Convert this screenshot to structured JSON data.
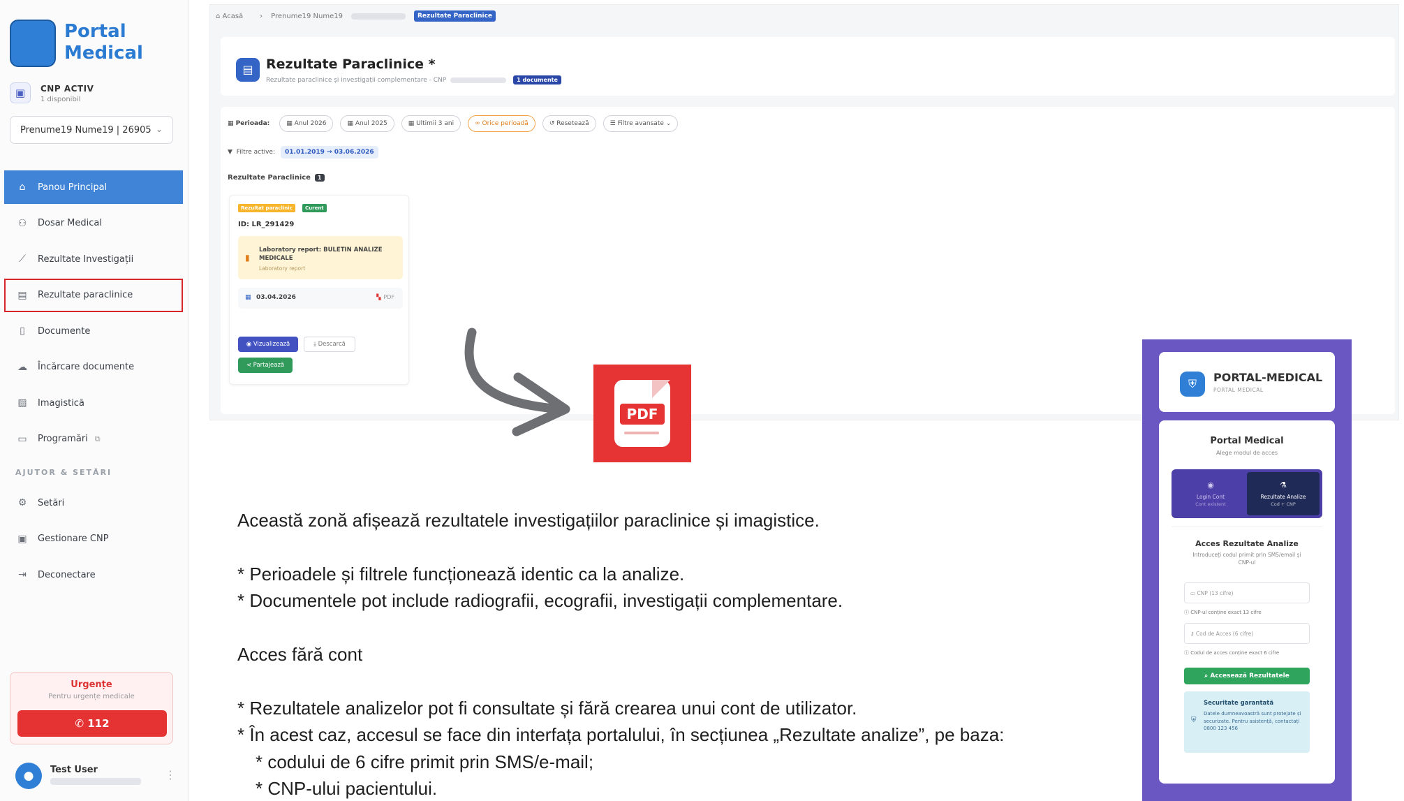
{
  "sidebar": {
    "logo_text": "Portal Medical",
    "cnp_title": "CNP ACTIV",
    "cnp_sub": "1 disponibil",
    "patient_select": "Prenume19 Nume19 | 26905",
    "nav": [
      {
        "label": "Panou Principal",
        "icon": "home-icon"
      },
      {
        "label": "Dosar Medical",
        "icon": "users-icon"
      },
      {
        "label": "Rezultate Investigații",
        "icon": "chart-icon"
      },
      {
        "label": "Rezultate paraclinice",
        "icon": "clipboard-icon"
      },
      {
        "label": "Documente",
        "icon": "document-icon"
      },
      {
        "label": "Încărcare documente",
        "icon": "cloud-upload-icon"
      },
      {
        "label": "Imagistică",
        "icon": "image-icon"
      },
      {
        "label": "Programări",
        "icon": "calendar-icon"
      }
    ],
    "section_label": "AJUTOR & SETĂRI",
    "nav2": [
      {
        "label": "Setări",
        "icon": "gear-icon"
      },
      {
        "label": "Gestionare CNP",
        "icon": "id-card-icon"
      },
      {
        "label": "Deconectare",
        "icon": "logout-icon"
      }
    ],
    "urgent_title": "Urgențe",
    "urgent_sub": "Pentru urgențe medicale",
    "urgent_phone": "112",
    "user_name": "Test User",
    "colors": {
      "active": "#3f84d7",
      "highlight": "#d7262c",
      "urgent": "#e53233"
    }
  },
  "main": {
    "breadcrumb": [
      "Acasă",
      "Prenume19 Nume19"
    ],
    "breadcrumb_active": "Rezultate Paraclinice",
    "title": "Rezultate Paraclinice *",
    "subtitle": "Rezultate paraclinice și investigații complementare - CNP",
    "doc_badge": "1 documente",
    "period_label": "Perioada:",
    "period_chips": [
      "Anul 2026",
      "Anul 2025",
      "Ultimii 3 ani",
      "Orice perioadă",
      "Resetează",
      "Filtre avansate"
    ],
    "active_label": "Filtre active:",
    "active_range": "01.01.2019 → 03.06.2026",
    "results_label": "Rezultate Paraclinice",
    "results_count": "1",
    "card": {
      "tag_type": "Rezultat paraclinic",
      "tag_status": "Curent",
      "id": "ID: LR_291429",
      "lab_title": "Laboratory report: BULETIN ANALIZE MEDICALE",
      "lab_sub": "Laboratory report",
      "date": "03.04.2026",
      "file_type": "PDF",
      "btn_view": "Vizualizează",
      "btn_download": "Descarcă",
      "btn_share": "Partajează"
    }
  },
  "pdf_label": "PDF",
  "description": {
    "line1": "Această zonă afișează rezultatele investigațiilor paraclinice și imagistice.",
    "line2": "* Perioadele și filtrele funcționează identic ca la analize.",
    "line3": "* Documentele pot include radiografii, ecografii, investigații complementare.",
    "line4": "Acces fără cont",
    "line5": "* Rezultatele analizelor pot fi consultate și fără crearea unui cont de utilizator.",
    "line6": "* În acest caz, accesul se face din interfața portalului, în secțiunea „Rezultate analize”, pe baza:",
    "line7": "* codului de 6 cifre primit prin SMS/e-mail;",
    "line8": "* CNP-ului pacientului."
  },
  "login": {
    "brand": "PORTAL-MEDICAL",
    "brand_sub": "PORTAL MEDICAL",
    "title": "Portal Medical",
    "subtitle": "Alege modul de acces",
    "tab_a": "Login Cont",
    "tab_a_sub": "Cont existent",
    "tab_b": "Rezultate Analize",
    "tab_b_sub": "Cod + CNP",
    "access_title": "Acces Rezultate Analize",
    "access_sub": "Introduceți codul primit prin SMS/email și CNP-ul",
    "cnp_placeholder": "CNP (13 cifre)",
    "cnp_hint": "CNP-ul conține exact 13 cifre",
    "code_placeholder": "Cod de Acces (6 cifre)",
    "code_hint": "Codul de acces conține exact 6 cifre",
    "submit": "Accesează Rezultatele",
    "security_title": "Securitate garantată",
    "security_body": "Datele dumneavoastră sunt protejate și securizate. Pentru asistență, contactați 0800 123 456",
    "colors": {
      "bg": "#6b57c2",
      "submit": "#2fa45c"
    }
  }
}
